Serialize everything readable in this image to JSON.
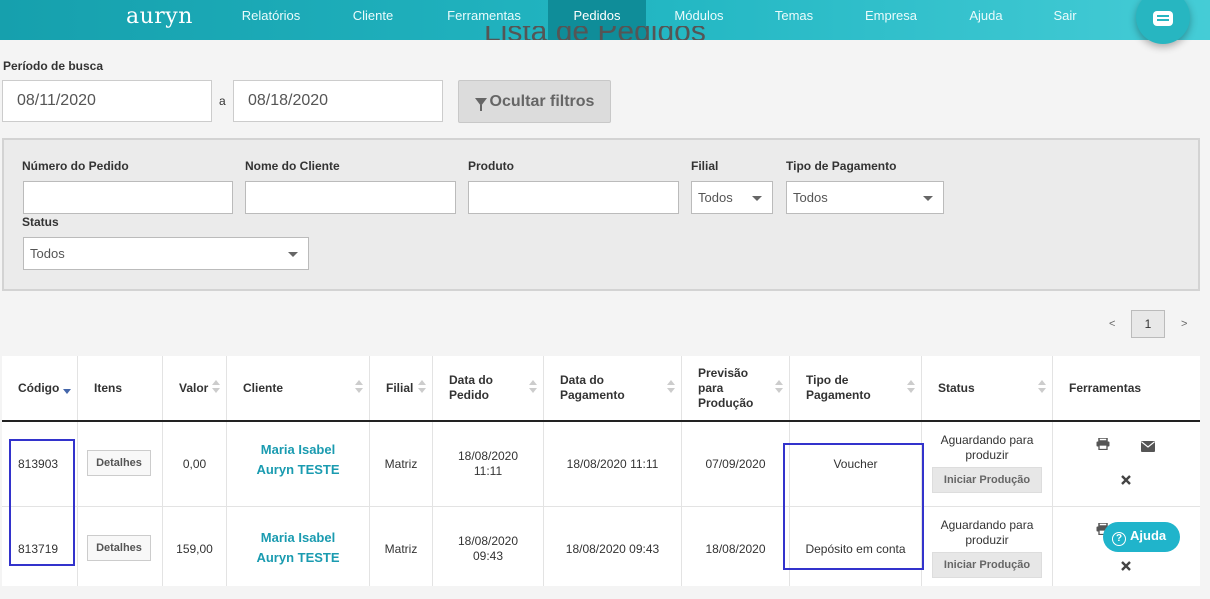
{
  "nav": {
    "logo": "auryn",
    "items": [
      {
        "label": "Relatórios",
        "active": false
      },
      {
        "label": "Cliente",
        "active": false
      },
      {
        "label": "Ferramentas",
        "active": false
      },
      {
        "label": "Pedidos",
        "active": true
      },
      {
        "label": "Módulos",
        "active": false
      },
      {
        "label": "Temas",
        "active": false
      },
      {
        "label": "Empresa",
        "active": false
      },
      {
        "label": "Ajuda",
        "active": false
      },
      {
        "label": "Sair",
        "active": false
      }
    ]
  },
  "page": {
    "title": "Lista de Pedidos"
  },
  "period": {
    "label": "Período de busca",
    "from": "08/11/2020",
    "separator": "a",
    "to": "08/18/2020",
    "toggle_filters": "Ocultar filtros"
  },
  "filters": {
    "order_number": {
      "label": "Número do Pedido",
      "value": ""
    },
    "client_name": {
      "label": "Nome do Cliente",
      "value": ""
    },
    "product": {
      "label": "Produto",
      "value": ""
    },
    "branch": {
      "label": "Filial",
      "value": "Todos"
    },
    "payment_type": {
      "label": "Tipo de Pagamento",
      "value": "Todos"
    },
    "status": {
      "label": "Status",
      "value": "Todos"
    }
  },
  "pagination": {
    "prev": "<",
    "current": "1",
    "next": ">"
  },
  "table": {
    "headers": {
      "codigo": "Código",
      "itens": "Itens",
      "valor": "Valor",
      "cliente": "Cliente",
      "filial": "Filial",
      "data_pedido": "Data do Pedido",
      "data_pagamento": "Data do Pagamento",
      "previsao": "Previsão para Produção",
      "tipo_pagamento": "Tipo de Pagamento",
      "status": "Status",
      "ferramentas": "Ferramentas"
    },
    "rows": [
      {
        "codigo": "813903",
        "itens": "Detalhes",
        "valor": "0,00",
        "cliente_l1": "Maria Isabel",
        "cliente_l2": "Auryn TESTE",
        "filial": "Matriz",
        "data_pedido_l1": "18/08/2020",
        "data_pedido_l2": "11:11",
        "data_pagamento": "18/08/2020 11:11",
        "previsao": "07/09/2020",
        "tipo_pagamento": "Voucher",
        "status_l1": "Aguardando para",
        "status_l2": "produzir",
        "status_action": "Iniciar Produção"
      },
      {
        "codigo": "813719",
        "itens": "Detalhes",
        "valor": "159,00",
        "cliente_l1": "Maria Isabel",
        "cliente_l2": "Auryn TESTE",
        "filial": "Matriz",
        "data_pedido_l1": "18/08/2020",
        "data_pedido_l2": "09:43",
        "data_pagamento": "18/08/2020 09:43",
        "previsao": "18/08/2020",
        "tipo_pagamento": "Depósito em conta",
        "status_l1": "Aguardando para",
        "status_l2": "produzir",
        "status_action": "Iniciar Produção"
      }
    ]
  },
  "help": {
    "label": "Ajuda"
  },
  "icons": [
    "chat-icon",
    "filter-icon",
    "print-icon",
    "mail-icon",
    "close-icon",
    "help-icon"
  ],
  "colors": {
    "nav": "#1fb0bd",
    "nav_active": "#0f8d99",
    "client_link": "#1a9bb0",
    "highlight": "#3333cc"
  }
}
